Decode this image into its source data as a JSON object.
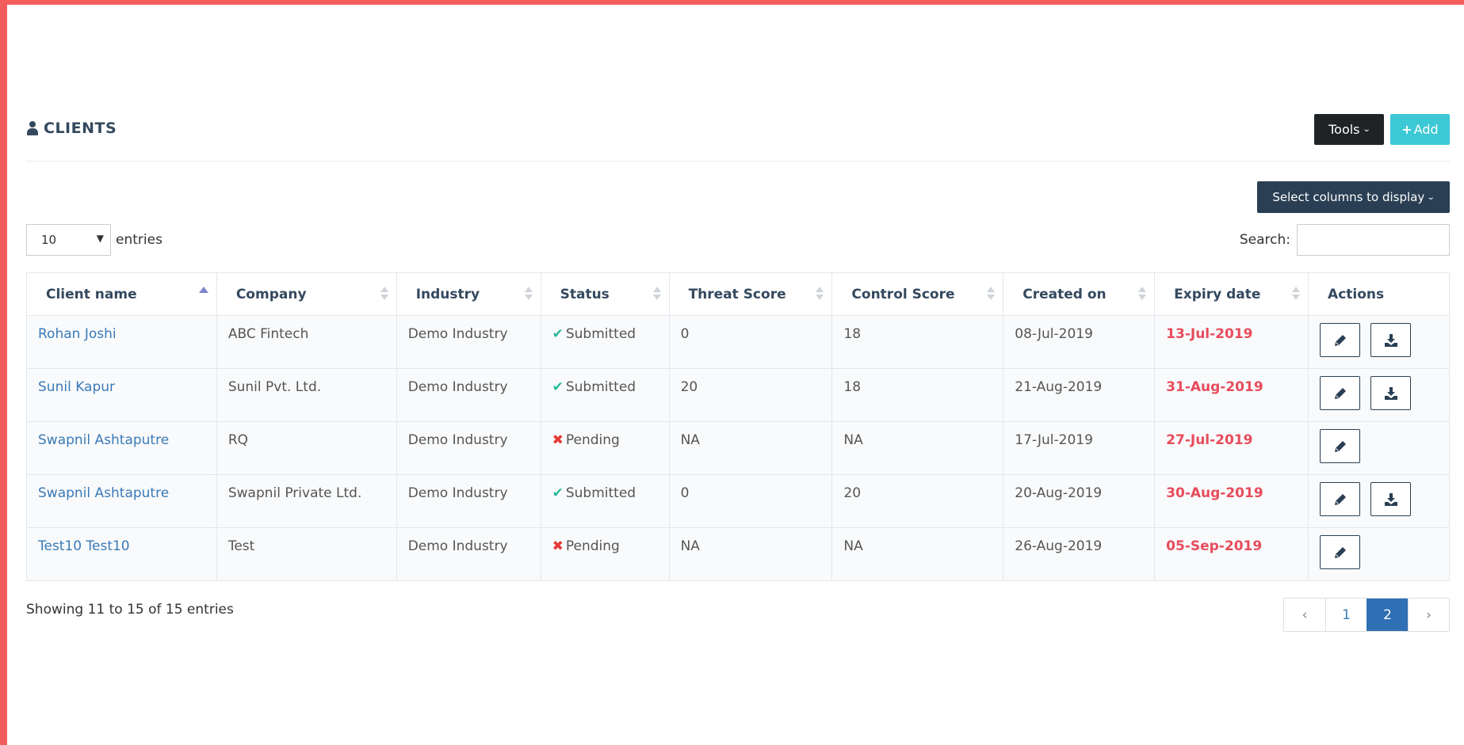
{
  "header": {
    "title": "CLIENTS",
    "tools_label": "Tools",
    "add_label": "Add"
  },
  "controls": {
    "columns_label": "Select columns to display",
    "length_value": "10",
    "length_suffix": "entries",
    "search_label": "Search:",
    "search_value": ""
  },
  "table": {
    "columns": [
      "Client name",
      "Company",
      "Industry",
      "Status",
      "Threat Score",
      "Control Score",
      "Created on",
      "Expiry date",
      "Actions"
    ],
    "rows": [
      {
        "client": "Rohan Joshi",
        "company": "ABC Fintech",
        "industry": "Demo Industry",
        "status": "Submitted",
        "threat": "0",
        "control": "18",
        "created": "08-Jul-2019",
        "expiry": "13-Jul-2019"
      },
      {
        "client": "Sunil Kapur",
        "company": "Sunil Pvt. Ltd.",
        "industry": "Demo Industry",
        "status": "Submitted",
        "threat": "20",
        "control": "18",
        "created": "21-Aug-2019",
        "expiry": "31-Aug-2019"
      },
      {
        "client": "Swapnil Ashtaputre",
        "company": "RQ",
        "industry": "Demo Industry",
        "status": "Pending",
        "threat": "NA",
        "control": "NA",
        "created": "17-Jul-2019",
        "expiry": "27-Jul-2019"
      },
      {
        "client": "Swapnil Ashtaputre",
        "company": "Swapnil Private Ltd.",
        "industry": "Demo Industry",
        "status": "Submitted",
        "threat": "0",
        "control": "20",
        "created": "20-Aug-2019",
        "expiry": "30-Aug-2019"
      },
      {
        "client": "Test10 Test10",
        "company": "Test",
        "industry": "Demo Industry",
        "status": "Pending",
        "threat": "NA",
        "control": "NA",
        "created": "26-Aug-2019",
        "expiry": "05-Sep-2019"
      }
    ]
  },
  "footer": {
    "info": "Showing 11 to 15 of 15 entries",
    "pages": [
      "1",
      "2"
    ],
    "current_page": "2"
  },
  "colors": {
    "frame": "#f25c5c",
    "tools_bg": "#1f2326",
    "add_bg": "#3cc8d4",
    "columns_bg": "#2a3f54",
    "link": "#3a7ab8",
    "submitted": "#26b99a",
    "pending": "#e53935",
    "expiry": "#e74c5c",
    "active_page": "#2f6fb3"
  },
  "icons": {
    "title": "user-icon",
    "submitted": "check-icon",
    "pending": "x-icon",
    "edit": "pencil-icon",
    "download": "download-icon"
  }
}
